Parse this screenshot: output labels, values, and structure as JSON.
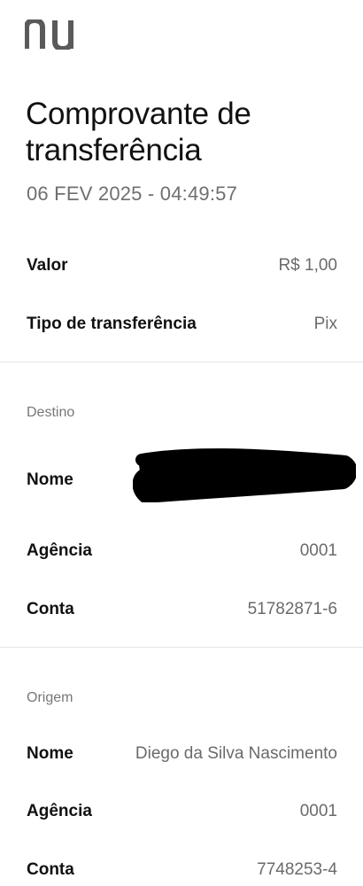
{
  "brand": {
    "logo_icon": "nubank-logo-icon",
    "logo_text": "nu",
    "logo_color": "#5a5a5a"
  },
  "header": {
    "title": "Comprovante de transferência",
    "datetime": "06 FEV 2025 - 04:49:57"
  },
  "summary": {
    "amount_label": "Valor",
    "amount_value": "R$ 1,00",
    "type_label": "Tipo de transferência",
    "type_value": "Pix"
  },
  "destination": {
    "section_title": "Destino",
    "name_label": "Nome",
    "name_value": "",
    "agency_label": "Agência",
    "agency_value": "0001",
    "account_label": "Conta",
    "account_value": "51782871-6"
  },
  "origin": {
    "section_title": "Origem",
    "name_label": "Nome",
    "name_value": "Diego da Silva Nascimento",
    "agency_label": "Agência",
    "agency_value": "0001",
    "account_label": "Conta",
    "account_value": "7748253-4"
  },
  "colors": {
    "text_primary": "#111111",
    "text_secondary": "#6a6a6a",
    "divider": "#e6e6e6",
    "redaction": "#000000"
  }
}
